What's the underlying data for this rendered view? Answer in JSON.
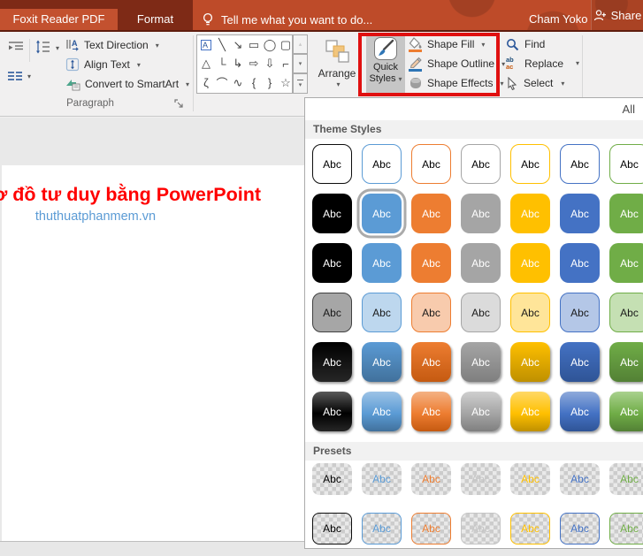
{
  "titlebar": {
    "tab_foxit": "Foxit Reader PDF",
    "tab_format": "Format",
    "tellme": "Tell me what you want to do...",
    "user_name": "Cham Yoko",
    "share_label": "Share"
  },
  "icons": {
    "dropdown": "▾",
    "up_arrow": "▴",
    "down_arrow": "▾",
    "replace_top": "ab",
    "replace_bottom": "ac"
  },
  "ribbon": {
    "text_direction_label": "Text Direction",
    "align_text_label": "Align Text",
    "convert_smartart_label": "Convert to SmartArt",
    "paragraph_group_label": "Paragraph",
    "arrange_label": "Arrange",
    "quick_label": "Quick",
    "styles_label": "Styles",
    "shape_fill_label": "Shape Fill",
    "shape_outline_label": "Shape Outline",
    "shape_effects_label": "Shape Effects",
    "find_label": "Find",
    "replace_label": "Replace",
    "select_label": "Select",
    "shape_glyphs_row1": [
      "A",
      "╲",
      "↘",
      "▭",
      "◯",
      "▢"
    ],
    "shape_glyphs_row2": [
      "△",
      "└",
      "↳",
      "⇨",
      "⇩",
      "⌐"
    ],
    "shape_glyphs_row3": [
      "ζ",
      "⌒",
      "∿",
      "{",
      "}",
      "☆"
    ]
  },
  "slide": {
    "title_text": "ơ đồ tư duy bằng PowerPoint",
    "title_color": "#FF0000",
    "link_text": "thuthuatphanmem.vn",
    "link_color": "#5B9BD5"
  },
  "gallery": {
    "all_label": "All",
    "theme_title": "Theme Styles",
    "presets_title": "Presets",
    "swatch_label": "Abc",
    "accents": [
      "#000000",
      "#5B9BD5",
      "#ED7D31",
      "#A5A5A5",
      "#FFC000",
      "#4472C4",
      "#70AD47"
    ],
    "outline_borders": [
      "#0D0D0D",
      "#5B9BD5",
      "#ED7D31",
      "#A5A5A5",
      "#FFC000",
      "#4472C4",
      "#70AD47"
    ],
    "subtle_fills": [
      "#A6A6A6",
      "#BDD7EE",
      "#F8CBAD",
      "#DBDBDB",
      "#FFE599",
      "#B4C7E7",
      "#C5E0B3"
    ],
    "subtle_borders": [
      "#404040",
      "#5B9BD5",
      "#ED7D31",
      "#A5A5A5",
      "#FFC000",
      "#4472C4",
      "#70AD47"
    ],
    "moderate_dark": [
      "#262626",
      "#41719C",
      "#C55A11",
      "#7F7F7F",
      "#BF9000",
      "#2F5496",
      "#538135"
    ],
    "intense_hi": [
      "#595959",
      "#9DC3E6",
      "#F4B183",
      "#CFCFCF",
      "#FFD966",
      "#8EAADB",
      "#A9D18E"
    ],
    "preset_text": [
      "#000000",
      "#5B9BD5",
      "#ED7D31",
      "#C5C5C5",
      "#FFC000",
      "#4472C4",
      "#70AD47"
    ],
    "preset_borders": [
      "#0D0D0D",
      "#5B9BD5",
      "#ED7D31",
      "#C5C5C5",
      "#FFC000",
      "#4472C4",
      "#70AD47"
    ],
    "theme_rows": [
      "outline",
      "solid",
      "solid",
      "subtle",
      "moderate",
      "intense"
    ],
    "selected": {
      "row": 1,
      "col": 1
    },
    "preset_rows": [
      "ghost",
      "ghost-border"
    ]
  }
}
